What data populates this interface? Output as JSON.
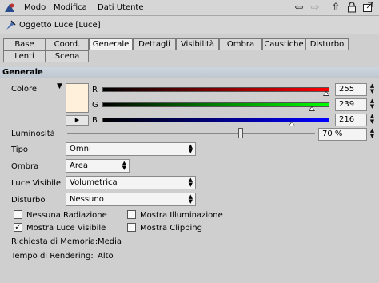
{
  "menu": {
    "items": [
      "Modo",
      "Modifica",
      "Dati Utente"
    ]
  },
  "toolbar": {
    "icons": [
      "back-arrow-icon",
      "forward-arrow-icon",
      "up-arrow-icon",
      "lock-icon",
      "new-window-icon"
    ]
  },
  "object": {
    "title": "Oggetto Luce [Luce]"
  },
  "tabs": {
    "row1": [
      "Base",
      "Coord.",
      "Generale",
      "Dettagli",
      "Visibilità",
      "Ombra",
      "Caustiche",
      "Disturbo"
    ],
    "row2": [
      "Lenti",
      "Scena"
    ],
    "active": "Generale"
  },
  "section": {
    "title": "Generale"
  },
  "color": {
    "label": "Colore",
    "swatch": "#fff0dc",
    "channels": [
      {
        "label": "R",
        "value": "255",
        "fraction": 1.0
      },
      {
        "label": "G",
        "value": "239",
        "fraction": 0.937
      },
      {
        "label": "B",
        "value": "216",
        "fraction": 0.847
      }
    ]
  },
  "luminosity": {
    "label": "Luminosità",
    "value": "70 %",
    "fraction": 0.7
  },
  "fields": {
    "tipo": {
      "label": "Tipo",
      "value": "Omni"
    },
    "ombra": {
      "label": "Ombra",
      "value": "Area"
    },
    "luce_visibile": {
      "label": "Luce Visibile",
      "value": "Volumetrica"
    },
    "disturbo": {
      "label": "Disturbo",
      "value": "Nessuno"
    }
  },
  "checks": {
    "nessuna_radiazione": {
      "label": "Nessuna Radiazione",
      "checked": false
    },
    "mostra_illuminazione": {
      "label": "Mostra Illuminazione",
      "checked": false
    },
    "mostra_luce_visibile": {
      "label": "Mostra Luce Visibile",
      "checked": true
    },
    "mostra_clipping": {
      "label": "Mostra Clipping",
      "checked": false
    }
  },
  "info": {
    "memoria_label": "Richiesta di Memoria:",
    "memoria_value": "Media",
    "rendering_label": "Tempo di Rendering:",
    "rendering_value": "Alto"
  }
}
